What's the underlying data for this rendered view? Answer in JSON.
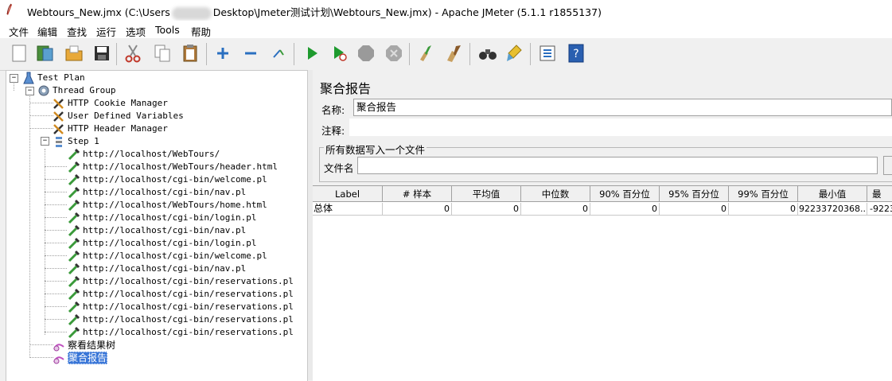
{
  "window": {
    "title_prefix": "Webtours_New.jmx (C:\\Users",
    "title_suffix": "Desktop\\Jmeter测试计划\\Webtours_New.jmx) - Apache JMeter (5.1.1 r1855137)"
  },
  "menu": [
    "文件",
    "编辑",
    "查找",
    "运行",
    "选项",
    "Tools",
    "帮助"
  ],
  "toolbar": [
    "new-icon",
    "template-icon",
    "open-icon",
    "save-icon",
    "cut-icon",
    "copy-icon",
    "paste-icon",
    "expand-icon",
    "collapse-icon",
    "toggle-icon",
    "start-icon",
    "start-no-timers-icon",
    "stop-icon",
    "shutdown-icon",
    "clear-icon",
    "clear-all-icon",
    "search-icon",
    "reset-search-icon",
    "function-helper-icon",
    "help-icon"
  ],
  "tree": {
    "test_plan": "Test Plan",
    "thread_group": "Thread Group",
    "config": [
      "HTTP Cookie Manager",
      "User Defined Variables",
      "HTTP Header Manager"
    ],
    "step": "Step 1",
    "samplers": [
      "http://localhost/WebTours/",
      "http://localhost/WebTours/header.html",
      "http://localhost/cgi-bin/welcome.pl",
      "http://localhost/cgi-bin/nav.pl",
      "http://localhost/WebTours/home.html",
      "http://localhost/cgi-bin/login.pl",
      "http://localhost/cgi-bin/nav.pl",
      "http://localhost/cgi-bin/login.pl",
      "http://localhost/cgi-bin/welcome.pl",
      "http://localhost/cgi-bin/nav.pl",
      "http://localhost/cgi-bin/reservations.pl",
      "http://localhost/cgi-bin/reservations.pl",
      "http://localhost/cgi-bin/reservations.pl",
      "http://localhost/cgi-bin/reservations.pl",
      "http://localhost/cgi-bin/reservations.pl"
    ],
    "listeners": [
      "察看结果树",
      "聚合报告"
    ]
  },
  "panel": {
    "title": "聚合报告",
    "name_label": "名称:",
    "name_value": "聚合报告",
    "comment_label": "注释:",
    "comment_value": "",
    "file_group_title": "所有数据写入一个文件",
    "filename_label": "文件名",
    "filename_value": ""
  },
  "table": {
    "headers": [
      "Label",
      "# 样本",
      "平均值",
      "中位数",
      "90% 百分位",
      "95% 百分位",
      "99% 百分位",
      "最小值",
      "最"
    ],
    "rows": [
      [
        "总体",
        "0",
        "0",
        "0",
        "0",
        "0",
        "0",
        "92233720368...",
        "-9223"
      ]
    ]
  }
}
